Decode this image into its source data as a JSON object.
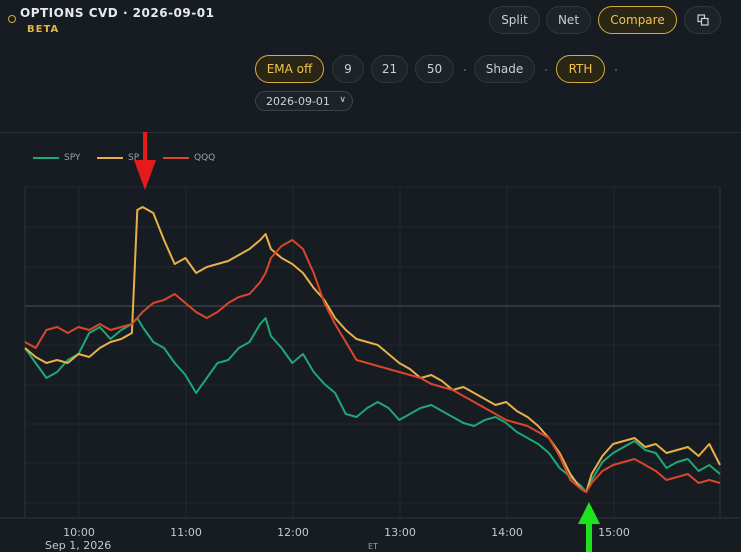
{
  "header": {
    "title": "OPTIONS CVD · 2026-09-01",
    "badge": "BETA",
    "view_buttons": [
      {
        "label": "Split",
        "active": false
      },
      {
        "label": "Net",
        "active": false
      },
      {
        "label": "Compare",
        "active": true
      }
    ],
    "popout_icon": "popout-icon"
  },
  "toolbar": {
    "ema_off": "EMA off",
    "ema_9": "9",
    "ema_21": "21",
    "ema_50": "50",
    "shade": "Shade",
    "rth": "RTH",
    "date_value": "2026-09-01"
  },
  "colors": {
    "spy": "#1fa774",
    "spx": "#e8b04a",
    "qqq": "#d9472b",
    "accent": "#e2b443",
    "red_arrow": "#e51b1b",
    "green_arrow": "#1ee21e"
  },
  "chart_data": {
    "type": "line",
    "legend": [
      "SPY",
      "SP",
      "QQQ"
    ],
    "x_ticks": [
      "10:00",
      "11:00",
      "12:00",
      "13:00",
      "14:00",
      "15:00"
    ],
    "x_date_label": "Sep 1, 2026",
    "x_unit": "ET",
    "y_range": [
      0,
      100
    ],
    "series": [
      {
        "name": "SPY",
        "color": "#1fa774",
        "x": [
          9.5,
          9.6,
          9.7,
          9.8,
          9.9,
          10.0,
          10.1,
          10.2,
          10.3,
          10.4,
          10.5,
          10.55,
          10.6,
          10.7,
          10.8,
          10.9,
          11.0,
          11.1,
          11.2,
          11.3,
          11.4,
          11.5,
          11.6,
          11.7,
          11.75,
          11.8,
          11.9,
          12.0,
          12.1,
          12.2,
          12.3,
          12.4,
          12.5,
          12.6,
          12.7,
          12.8,
          12.9,
          13.0,
          13.1,
          13.2,
          13.3,
          13.4,
          13.5,
          13.6,
          13.7,
          13.8,
          13.9,
          14.0,
          14.1,
          14.2,
          14.3,
          14.4,
          14.5,
          14.6,
          14.7,
          14.75,
          14.8,
          14.9,
          15.0,
          15.1,
          15.2,
          15.3,
          15.4,
          15.5,
          15.6,
          15.7,
          15.8,
          15.9,
          16.0
        ],
        "y": [
          50,
          45,
          40,
          42,
          46,
          48,
          55,
          57,
          53,
          56,
          58,
          60,
          57,
          52,
          50,
          45,
          41,
          35,
          40,
          45,
          46,
          50,
          52,
          58,
          60,
          54,
          50,
          45,
          48,
          42,
          38,
          35,
          28,
          27,
          30,
          32,
          30,
          26,
          28,
          30,
          31,
          29,
          27,
          25,
          24,
          26,
          27,
          25,
          22,
          20,
          18,
          15,
          10,
          7,
          4,
          2,
          6,
          12,
          15,
          17,
          19,
          16,
          15,
          10,
          12,
          13,
          9,
          11,
          8
        ]
      },
      {
        "name": "SP",
        "color": "#e8b04a",
        "x": [
          9.5,
          9.6,
          9.7,
          9.8,
          9.9,
          10.0,
          10.1,
          10.2,
          10.3,
          10.4,
          10.5,
          10.55,
          10.6,
          10.7,
          10.8,
          10.9,
          11.0,
          11.1,
          11.2,
          11.3,
          11.4,
          11.5,
          11.6,
          11.7,
          11.75,
          11.8,
          11.9,
          12.0,
          12.1,
          12.2,
          12.3,
          12.4,
          12.5,
          12.6,
          12.7,
          12.8,
          12.9,
          13.0,
          13.1,
          13.2,
          13.3,
          13.4,
          13.5,
          13.6,
          13.7,
          13.8,
          13.9,
          14.0,
          14.1,
          14.2,
          14.3,
          14.4,
          14.5,
          14.6,
          14.7,
          14.75,
          14.8,
          14.9,
          15.0,
          15.1,
          15.2,
          15.3,
          15.4,
          15.5,
          15.6,
          15.7,
          15.8,
          15.9,
          16.0
        ],
        "y": [
          50,
          47,
          45,
          46,
          45,
          48,
          47,
          50,
          52,
          53,
          55,
          96,
          97,
          95,
          86,
          78,
          80,
          75,
          77,
          78,
          79,
          81,
          83,
          86,
          88,
          83,
          80,
          78,
          75,
          70,
          66,
          60,
          56,
          53,
          52,
          51,
          48,
          45,
          43,
          40,
          41,
          39,
          36,
          37,
          35,
          33,
          31,
          32,
          29,
          27,
          24,
          20,
          15,
          8,
          3,
          2,
          8,
          14,
          18,
          19,
          20,
          17,
          18,
          15,
          16,
          17,
          14,
          18,
          11
        ]
      },
      {
        "name": "QQQ",
        "color": "#d9472b",
        "x": [
          9.5,
          9.6,
          9.7,
          9.8,
          9.9,
          10.0,
          10.1,
          10.2,
          10.3,
          10.4,
          10.5,
          10.55,
          10.6,
          10.7,
          10.8,
          10.9,
          11.0,
          11.1,
          11.2,
          11.3,
          11.4,
          11.5,
          11.6,
          11.7,
          11.75,
          11.8,
          11.9,
          12.0,
          12.1,
          12.2,
          12.3,
          12.4,
          12.5,
          12.6,
          12.7,
          12.8,
          12.9,
          13.0,
          13.1,
          13.2,
          13.3,
          13.4,
          13.5,
          13.6,
          13.7,
          13.8,
          13.9,
          14.0,
          14.1,
          14.2,
          14.3,
          14.4,
          14.5,
          14.6,
          14.7,
          14.75,
          14.8,
          14.9,
          15.0,
          15.1,
          15.2,
          15.3,
          15.4,
          15.5,
          15.6,
          15.7,
          15.8,
          15.9,
          16.0
        ],
        "y": [
          52,
          50,
          56,
          57,
          55,
          57,
          56,
          58,
          56,
          57,
          58,
          60,
          62,
          65,
          66,
          68,
          65,
          62,
          60,
          62,
          65,
          67,
          68,
          72,
          75,
          80,
          84,
          86,
          83,
          75,
          65,
          58,
          52,
          46,
          45,
          44,
          43,
          42,
          41,
          40,
          38,
          37,
          36,
          34,
          32,
          30,
          28,
          26,
          25,
          24,
          22,
          20,
          14,
          6,
          3,
          2,
          5,
          9,
          11,
          12,
          13,
          11,
          9,
          6,
          7,
          8,
          5,
          6,
          5
        ]
      }
    ]
  }
}
